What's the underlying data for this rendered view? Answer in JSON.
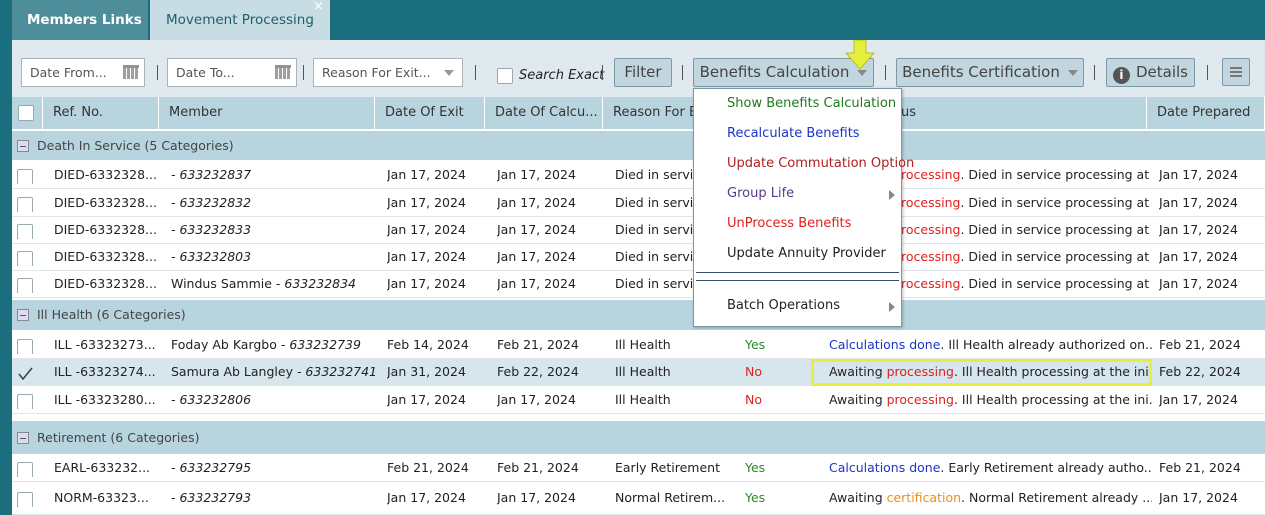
{
  "tabs": [
    {
      "label": "Members Links"
    },
    {
      "label": "Movement Processing",
      "close": "×"
    }
  ],
  "toolbar": {
    "date_from": "Date From...",
    "date_to": "Date To...",
    "reason": "Reason For Exit...",
    "search_exact": "Search Exact",
    "filter": "Filter",
    "benefits_calculation": "Benefits Calculation",
    "benefits_certification": "Benefits Certification",
    "details": "Details",
    "info_glyph": "i"
  },
  "columns": [
    "Ref. No.",
    "Member",
    "Date Of Exit",
    "Date Of Calcu...",
    "Reason For Exit",
    "Status",
    "Date Prepared"
  ],
  "columns_visible": {
    "reason": "Reason For Ex",
    "status": "us"
  },
  "groups": [
    {
      "label": "Death In Service (5 Categories)"
    },
    {
      "label": "Ill Health (6 Categories)"
    },
    {
      "label": "Retirement (6 Categories)"
    }
  ],
  "rows": [
    {
      "ref": "DIED-6332328...",
      "name": "",
      "id": "- 633232837",
      "exit": "Jan 17, 2024",
      "calc": "Jan 17, 2024",
      "reason": "Died in servic",
      "s1": "",
      "s2": "rocessing",
      "s3": ". Died in service processing at ...",
      "prep": "Jan 17, 2024"
    },
    {
      "ref": "DIED-6332328...",
      "name": "",
      "id": "- 633232832",
      "exit": "Jan 17, 2024",
      "calc": "Jan 17, 2024",
      "reason": "Died in servic",
      "s1": "",
      "s2": "rocessing",
      "s3": ". Died in service processing at ...",
      "prep": "Jan 17, 2024"
    },
    {
      "ref": "DIED-6332328...",
      "name": "",
      "id": "- 633232833",
      "exit": "Jan 17, 2024",
      "calc": "Jan 17, 2024",
      "reason": "Died in servic",
      "s1": "",
      "s2": "rocessing",
      "s3": ". Died in service processing at ...",
      "prep": "Jan 17, 2024"
    },
    {
      "ref": "DIED-6332328...",
      "name": "",
      "id": "- 633232803",
      "exit": "Jan 17, 2024",
      "calc": "Jan 17, 2024",
      "reason": "Died in servic",
      "s1": "",
      "s2": "rocessing",
      "s3": ". Died in service processing at ...",
      "prep": "Jan 17, 2024"
    },
    {
      "ref": "DIED-6332328...",
      "name": "Windus Sammie ",
      "id": "- 633232834",
      "exit": "Jan 17, 2024",
      "calc": "Jan 17, 2024",
      "reason": "Died in servic",
      "s1": "",
      "s2": "rocessing",
      "s3": ". Died in service processing at ...",
      "prep": "Jan 17, 2024"
    },
    {
      "ref": "ILL -63323273...",
      "name": "Foday Ab Kargbo ",
      "id": "- 633232739",
      "exit": "Feb 14, 2024",
      "calc": "Feb 21, 2024",
      "reason": "Ill Health",
      "yn": "Yes",
      "s1": "Calculations done",
      "s2": "",
      "s3": ". Ill Health already authorized on...",
      "prep": "Feb 21, 2024"
    },
    {
      "ref": "ILL -63323274...",
      "name": "Samura Ab Langley ",
      "id": "- 633232741",
      "exit": "Jan 31, 2024",
      "calc": "Feb 22, 2024",
      "reason": "Ill Health",
      "yn": "No",
      "s1": "Awaiting ",
      "s2": "processing",
      "s3": ". Ill Health processing at the ini...",
      "prep": "Feb 22, 2024"
    },
    {
      "ref": "ILL -63323280...",
      "name": "",
      "id": "- 633232806",
      "exit": "Jan 17, 2024",
      "calc": "Jan 17, 2024",
      "reason": "Ill Health",
      "yn": "No",
      "s1": "Awaiting ",
      "s2": "processing",
      "s3": ". Ill Health processing at the ini...",
      "prep": "Jan 17, 2024"
    },
    {
      "ref": "EARL-633232...",
      "name": "",
      "id": "- 633232795",
      "exit": "Feb 21, 2024",
      "calc": "Feb 21, 2024",
      "reason": "Early Retirement",
      "yn": "Yes",
      "s1": "Calculations done",
      "s2": "",
      "s3": ". Early Retirement already autho...",
      "prep": "Feb 21, 2024"
    },
    {
      "ref": "NORM-63323...",
      "name": "",
      "id": "- 633232793",
      "exit": "Jan 17, 2024",
      "calc": "Jan 17, 2024",
      "reason": "Normal Retirem...",
      "yn": "Yes",
      "s1": "Awaiting ",
      "s2": "certification",
      "s3": ". Normal Retirement already ...",
      "prep": "Jan 17, 2024"
    }
  ],
  "menu": [
    {
      "label": "Show Benefits Calculation",
      "color": "#1f7a1f"
    },
    {
      "label": "Recalculate Benefits",
      "color": "#1a35c8"
    },
    {
      "label": "Update Commutation Option",
      "color": "#b02020"
    },
    {
      "label": "Group Life",
      "color": "#5a3a8a"
    },
    {
      "label": "UnProcess Benefits",
      "color": "#e02020"
    },
    {
      "label": "Update Annuity Provider",
      "color": "#222222"
    },
    {
      "label": "Batch Operations",
      "color": "#222222"
    }
  ],
  "colors": {
    "teal": "#1b6e7d",
    "header": "#b8d5df",
    "pointer": "#e6ef3a"
  }
}
